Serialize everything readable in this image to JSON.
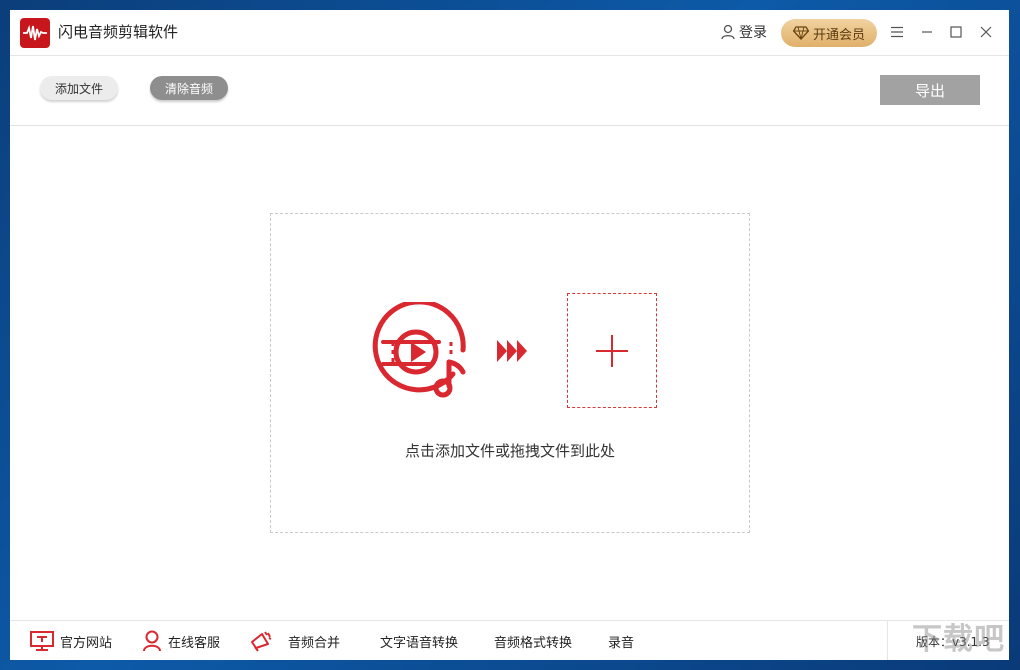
{
  "app": {
    "title": "闪电音频剪辑软件"
  },
  "header": {
    "login_label": "登录",
    "vip_label": "开通会员"
  },
  "toolbar": {
    "add_file_label": "添加文件",
    "clear_audio_label": "清除音频",
    "export_label": "导出"
  },
  "dropzone": {
    "hint": "点击添加文件或拖拽文件到此处"
  },
  "bottom": {
    "items": [
      {
        "label": "官方网站",
        "icon": "monitor-icon"
      },
      {
        "label": "在线客服",
        "icon": "user-icon"
      },
      {
        "label": "音频合并",
        "icon": "megaphone-icon"
      },
      {
        "label": "文字语音转换"
      },
      {
        "label": "音频格式转换"
      },
      {
        "label": "录音"
      }
    ],
    "version": "版本：v3.1.3"
  },
  "watermark": "下载吧",
  "colors": {
    "brand": "#c8161d",
    "accent_red": "#d9282f",
    "vip_gold": "#e0b06a"
  }
}
